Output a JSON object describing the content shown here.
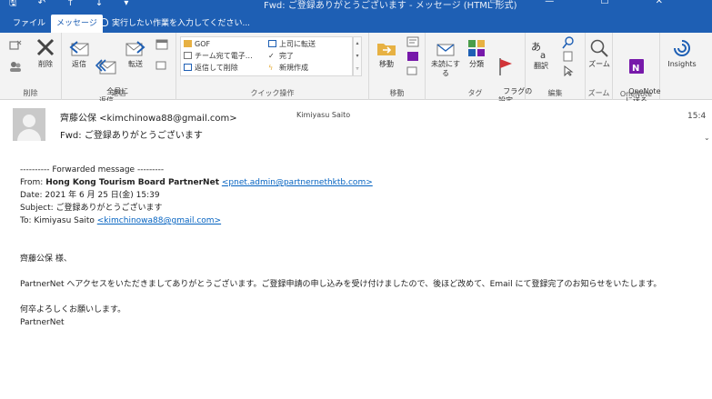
{
  "titlebar": {
    "title": "Fwd: ご登録ありがとうございます - メッセージ (HTML 形式)",
    "qat_glyphs": "🖫 ↶ ↑ ↓ ▾",
    "win_controls": "▭ — ☐ ✕"
  },
  "tabs": [
    {
      "label": "ファイル"
    },
    {
      "label": "メッセージ"
    }
  ],
  "tellme": {
    "text": "実行したい作業を入力してください..."
  },
  "ribbon": {
    "delete_group": {
      "label": "削除",
      "ignore": "",
      "delete": "削除"
    },
    "respond_group": {
      "label": "返信",
      "reply": "返信",
      "reply_all": "全員に\n返信",
      "forward": "転送"
    },
    "quick_group": {
      "label": "クイック操作",
      "items": [
        "GOF",
        "チーム宛て電子…",
        "返信して削除",
        "上司に転送",
        "完了",
        "新規作成"
      ]
    },
    "move_group": {
      "label": "移動",
      "move": "移動"
    },
    "tags_group": {
      "label": "タグ",
      "unread": "未読にする",
      "categorize": "分類",
      "flag": "フラグの\n設定"
    },
    "edit_group": {
      "label": "編集",
      "translate": "翻訳"
    },
    "zoom_group": {
      "label": "ズーム",
      "zoom": "ズーム"
    },
    "onenote_group": {
      "label": "OneNote",
      "send": "OneNote\nに送る"
    },
    "insights": {
      "label": "Insights"
    }
  },
  "message": {
    "sender": "齊藤公保 <kimchinowa88@gmail.com>",
    "recipient": "Kimiyasu Saito",
    "subject": "Fwd: ご登録ありがとうございます",
    "time": "15:4"
  },
  "body": {
    "forward_line": "---------- Forwarded message ---------",
    "from_label": "From: ",
    "from_name": "Hong Kong Tourism Board PartnerNet",
    "from_email": "<pnet.admin@partnernethktb.com>",
    "date": "Date: 2021 年 6 月 25 日(金) 15:39",
    "subject": "Subject: ご登録ありがとうございます",
    "to_label": "To: Kimiyasu Saito ",
    "to_email": "<kimchinowa88@gmail.com>",
    "greeting": "齊藤公保 様、",
    "paragraph": "PartnerNet へアクセスをいただきましてありがとうございます。ご登録申請の申し込みを受け付けましたので、後ほど改めて、Email にて登録完了のお知らせをいたします。",
    "closing": "何卒よろしくお願いします。",
    "signature": "PartnerNet"
  },
  "colors": {
    "ribbon_blue": "#1e5fb4",
    "onenote_purple": "#7719aa",
    "link_blue": "#0563c1",
    "flag_red": "#d13438"
  }
}
